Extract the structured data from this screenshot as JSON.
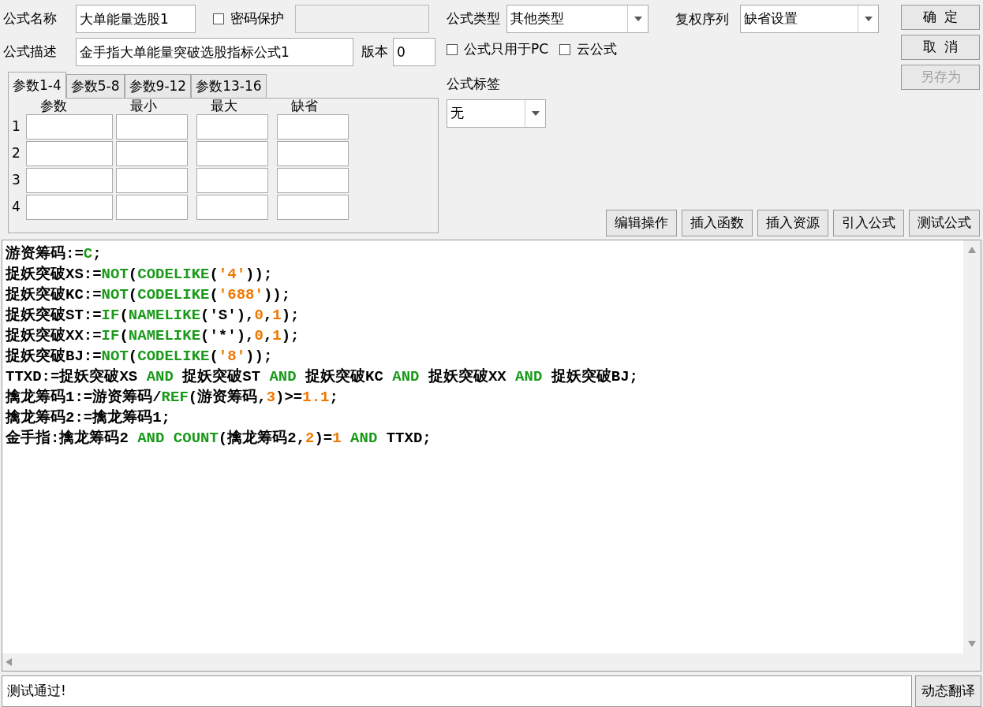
{
  "form": {
    "name_label": "公式名称",
    "name": "大单能量选股1",
    "password": {
      "label": "密码保护",
      "checked": false
    },
    "desc_label": "公式描述",
    "desc": "金手指大单能量突破选股指标公式1",
    "version_label": "版本",
    "version": "0",
    "type_label": "公式类型",
    "type": "其他类型",
    "pc_only": {
      "label": "公式只用于PC",
      "checked": false
    },
    "cloud": {
      "label": "云公式",
      "checked": false
    },
    "tag_label": "公式标签",
    "tag": "无",
    "rights_label": "复权序列",
    "rights": "缺省设置"
  },
  "buttons": [
    {
      "label": "确  定",
      "disabled": false
    },
    {
      "label": "取  消",
      "disabled": false
    },
    {
      "label": "另存为",
      "disabled": true
    }
  ],
  "tabs": [
    {
      "label": "参数1-4",
      "selected": true
    },
    {
      "label": "参数5-8",
      "selected": false
    },
    {
      "label": "参数9-12",
      "selected": false
    },
    {
      "label": "参数13-16",
      "selected": false
    }
  ],
  "param_columns": [
    "参数",
    "最小",
    "最大",
    "缺省"
  ],
  "param_rows": [
    "1",
    "2",
    "3",
    "4"
  ],
  "tools": [
    "编辑操作",
    "插入函数",
    "插入资源",
    "引入公式",
    "测试公式"
  ],
  "code": [
    [
      {
        "kind": "text",
        "t": "游资筹码:="
      },
      {
        "kind": "func",
        "t": "C"
      },
      {
        "kind": "text",
        "t": ";"
      }
    ],
    [
      {
        "kind": "text",
        "t": "捉妖突破XS:="
      },
      {
        "kind": "func",
        "t": "NOT"
      },
      {
        "kind": "text",
        "t": "("
      },
      {
        "kind": "func",
        "t": "CODELIKE"
      },
      {
        "kind": "text",
        "t": "("
      },
      {
        "kind": "num",
        "t": "'4'"
      },
      {
        "kind": "text",
        "t": "));"
      }
    ],
    [
      {
        "kind": "text",
        "t": "捉妖突破KC:="
      },
      {
        "kind": "func",
        "t": "NOT"
      },
      {
        "kind": "text",
        "t": "("
      },
      {
        "kind": "func",
        "t": "CODELIKE"
      },
      {
        "kind": "text",
        "t": "("
      },
      {
        "kind": "num",
        "t": "'688'"
      },
      {
        "kind": "text",
        "t": "));"
      }
    ],
    [
      {
        "kind": "text",
        "t": "捉妖突破ST:="
      },
      {
        "kind": "func",
        "t": "IF"
      },
      {
        "kind": "text",
        "t": "("
      },
      {
        "kind": "func",
        "t": "NAMELIKE"
      },
      {
        "kind": "text",
        "t": "('S'),"
      },
      {
        "kind": "num",
        "t": "0"
      },
      {
        "kind": "text",
        "t": ","
      },
      {
        "kind": "num",
        "t": "1"
      },
      {
        "kind": "text",
        "t": ");"
      }
    ],
    [
      {
        "kind": "text",
        "t": "捉妖突破XX:="
      },
      {
        "kind": "func",
        "t": "IF"
      },
      {
        "kind": "text",
        "t": "("
      },
      {
        "kind": "func",
        "t": "NAMELIKE"
      },
      {
        "kind": "text",
        "t": "('*'),"
      },
      {
        "kind": "num",
        "t": "0"
      },
      {
        "kind": "text",
        "t": ","
      },
      {
        "kind": "num",
        "t": "1"
      },
      {
        "kind": "text",
        "t": ");"
      }
    ],
    [
      {
        "kind": "text",
        "t": "捉妖突破BJ:="
      },
      {
        "kind": "func",
        "t": "NOT"
      },
      {
        "kind": "text",
        "t": "("
      },
      {
        "kind": "func",
        "t": "CODELIKE"
      },
      {
        "kind": "text",
        "t": "("
      },
      {
        "kind": "num",
        "t": "'8'"
      },
      {
        "kind": "text",
        "t": "));"
      }
    ],
    [
      {
        "kind": "text",
        "t": "TTXD:=捉妖突破XS "
      },
      {
        "kind": "func",
        "t": "AND"
      },
      {
        "kind": "text",
        "t": " 捉妖突破ST "
      },
      {
        "kind": "func",
        "t": "AND"
      },
      {
        "kind": "text",
        "t": " 捉妖突破KC "
      },
      {
        "kind": "func",
        "t": "AND"
      },
      {
        "kind": "text",
        "t": " 捉妖突破XX "
      },
      {
        "kind": "func",
        "t": "AND"
      },
      {
        "kind": "text",
        "t": " 捉妖突破BJ;"
      }
    ],
    [
      {
        "kind": "text",
        "t": "擒龙筹码1:=游资筹码/"
      },
      {
        "kind": "func",
        "t": "REF"
      },
      {
        "kind": "text",
        "t": "(游资筹码,"
      },
      {
        "kind": "num",
        "t": "3"
      },
      {
        "kind": "text",
        "t": ")>="
      },
      {
        "kind": "num",
        "t": "1.1"
      },
      {
        "kind": "text",
        "t": ";"
      }
    ],
    [
      {
        "kind": "text",
        "t": "擒龙筹码2:=擒龙筹码1;"
      }
    ],
    [
      {
        "kind": "text",
        "t": "金手指:擒龙筹码2 "
      },
      {
        "kind": "func",
        "t": "AND COUNT"
      },
      {
        "kind": "text",
        "t": "(擒龙筹码2,"
      },
      {
        "kind": "num",
        "t": "2"
      },
      {
        "kind": "text",
        "t": ")="
      },
      {
        "kind": "num",
        "t": "1"
      },
      {
        "kind": "func",
        "t": " AND"
      },
      {
        "kind": "text",
        "t": " TTXD;"
      }
    ]
  ],
  "status": "测试通过!",
  "translate_button": "动态翻译"
}
